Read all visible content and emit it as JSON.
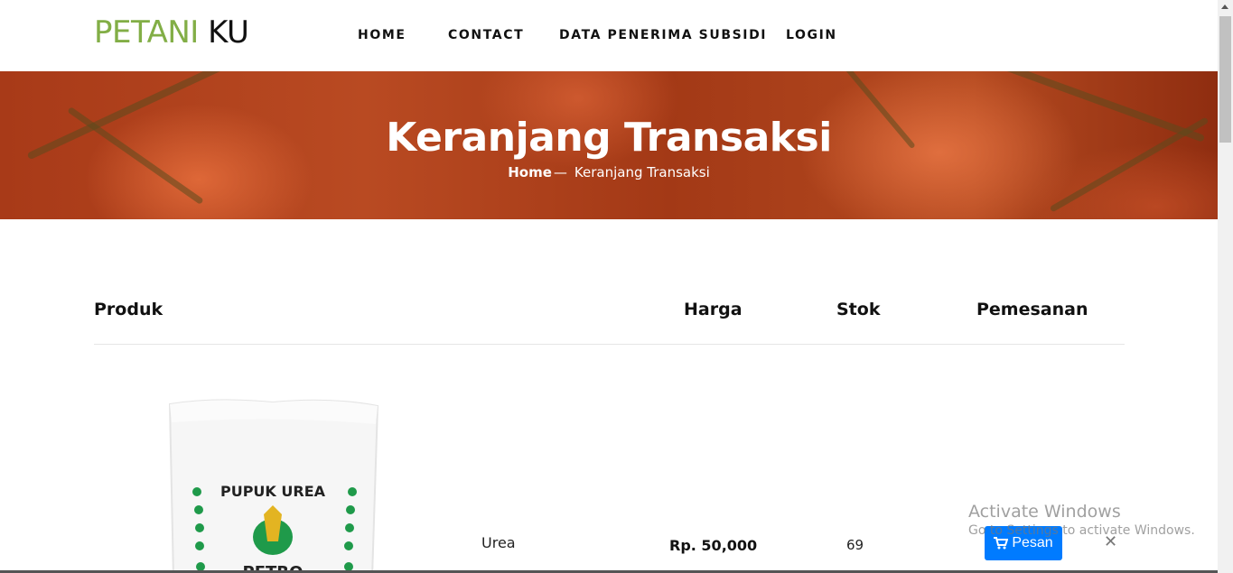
{
  "brand": {
    "part1": "PETANI",
    "part2": " KU",
    "accent": "#82ae46"
  },
  "nav": {
    "items": [
      {
        "label": "HOME"
      },
      {
        "label": "CONTACT"
      },
      {
        "label": "DATA PENERIMA SUBSIDI"
      },
      {
        "label": "LOGIN"
      }
    ]
  },
  "hero": {
    "title": "Keranjang Transaksi",
    "breadcrumb_home": "Home",
    "breadcrumb_sep": "—",
    "breadcrumb_current": "Keranjang Transaksi"
  },
  "table": {
    "headers": {
      "produk": "Produk",
      "harga": "Harga",
      "stok": "Stok",
      "pemesanan": "Pemesanan"
    },
    "rows": [
      {
        "image_text_top": "PUPUK UREA",
        "image_text_bottom": "PETRO",
        "name": "Urea",
        "price": "Rp. 50,000",
        "stock": "69",
        "button": "Pesan",
        "remove": "✕"
      }
    ]
  },
  "watermark": {
    "line1": "Activate Windows",
    "line2": "Go to Settings to activate Windows."
  },
  "icons": {
    "cart": "cart-icon",
    "close": "close-icon"
  },
  "colors": {
    "primary_button": "#007bff"
  }
}
